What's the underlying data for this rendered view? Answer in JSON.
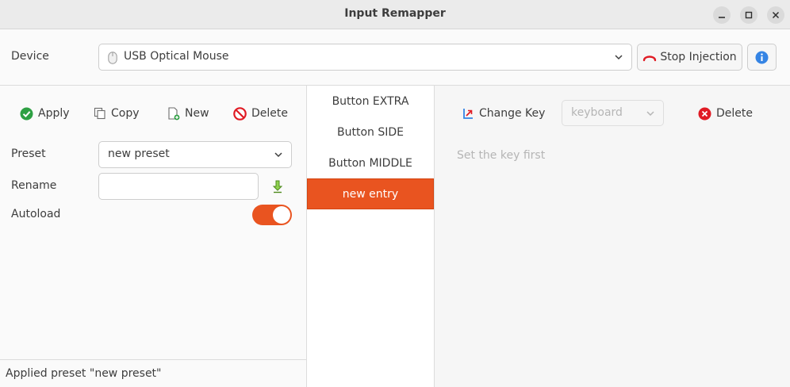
{
  "window": {
    "title": "Input Remapper",
    "controls": [
      "minimize-icon",
      "maximize-icon",
      "close-icon"
    ]
  },
  "device": {
    "label": "Device",
    "selected": "USB Optical Mouse",
    "icon": "mouse-icon",
    "stop_injection_label": "Stop Injection",
    "info_icon": "info-icon"
  },
  "preset_toolbar": {
    "apply": "Apply",
    "copy": "Copy",
    "new": "New",
    "delete": "Delete"
  },
  "preset": {
    "preset_label": "Preset",
    "preset_value": "new preset",
    "rename_label": "Rename",
    "rename_value": "",
    "autoload_label": "Autoload",
    "autoload_on": true
  },
  "status": "Applied preset \"new preset\"",
  "mappings": [
    {
      "label": "Button EXTRA",
      "selected": false
    },
    {
      "label": "Button SIDE",
      "selected": false
    },
    {
      "label": "Button MIDDLE",
      "selected": false
    },
    {
      "label": "new entry",
      "selected": true
    }
  ],
  "editor": {
    "change_key": "Change Key",
    "target_placeholder": "keyboard",
    "delete": "Delete",
    "hint": "Set the key first"
  },
  "colors": {
    "accent": "#e95420",
    "apply_green": "#2ea043",
    "delete_red": "#e01b24",
    "stop_red": "#e01b24",
    "info_blue": "#3584e4"
  }
}
